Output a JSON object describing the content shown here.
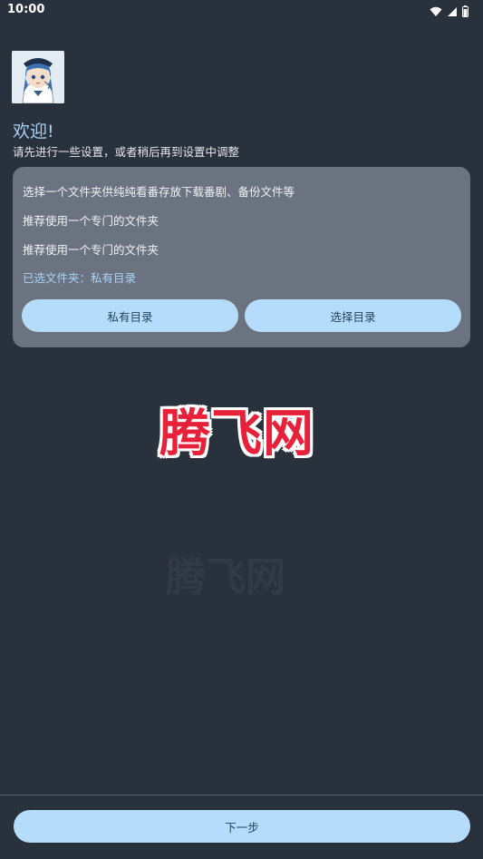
{
  "status_bar": {
    "time": "10:00",
    "icons": [
      "wifi-icon",
      "signal-icon",
      "battery-icon"
    ]
  },
  "header": {
    "avatar_icon": "anime-avatar-icon",
    "title": "欢迎!",
    "subtitle": "请先进行一些设置，或者稍后再到设置中调整"
  },
  "storage_card": {
    "line1": "选择一个文件夹供纯纯看番存放下载番剧、备份文件等",
    "line2": "推荐使用一个专门的文件夹",
    "line3": "推荐使用一个专门的文件夹",
    "selected": "已选文件夹：私有目录",
    "private_button": "私有目录",
    "choose_button": "选择目录"
  },
  "watermark": {
    "text": "腾飞网",
    "faint_text": "腾飞网"
  },
  "footer": {
    "next_button": "下一步"
  },
  "colors": {
    "background": "#28313c",
    "card": "#6b7380",
    "accent_button": "#b6dcfb",
    "title_accent": "#a8d2f5",
    "watermark": "#e8213a"
  }
}
